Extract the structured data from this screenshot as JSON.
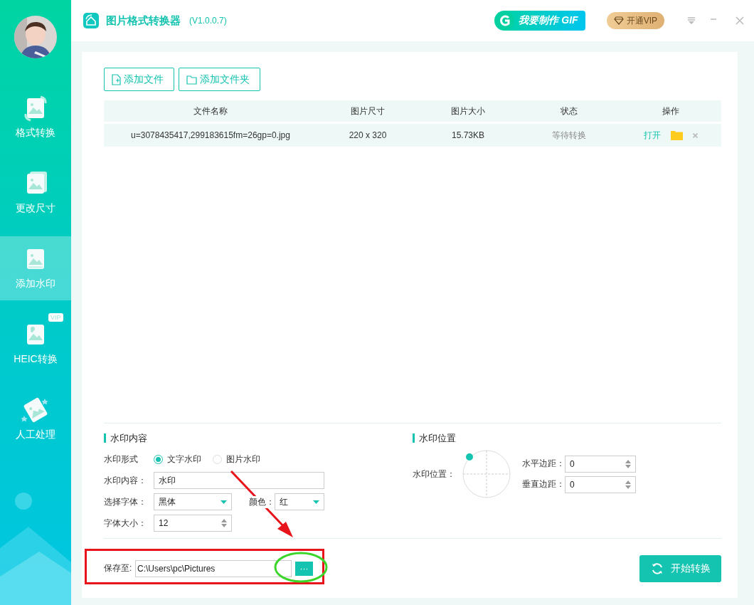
{
  "app": {
    "title": "图片格式转换器",
    "version": "(V1.0.0.7)"
  },
  "header": {
    "gif_button": "我要制作 GIF",
    "vip_button": "开通VIP"
  },
  "sidebar": {
    "items": [
      {
        "label": "格式转换",
        "selected": false,
        "kind": "convert"
      },
      {
        "label": "更改尺寸",
        "selected": false,
        "kind": "resize"
      },
      {
        "label": "添加水印",
        "selected": true,
        "kind": "watermark"
      },
      {
        "label": "HEIC转换",
        "selected": false,
        "kind": "heic",
        "badge": "VIP"
      },
      {
        "label": "人工处理",
        "selected": false,
        "kind": "manual"
      }
    ]
  },
  "toolbar": {
    "buttons": [
      {
        "label": "添加文件",
        "kind": "file"
      },
      {
        "label": "添加文件夹",
        "kind": "folder"
      }
    ]
  },
  "table": {
    "columns": [
      "文件名称",
      "图片尺寸",
      "图片大小",
      "状态",
      "操作"
    ],
    "rows": [
      {
        "name": "u=3078435417,299183615fm=26gp=0.jpg",
        "dimensions": "220 x 320",
        "size": "15.73KB",
        "status": "等待转换",
        "open_link": "打开"
      }
    ]
  },
  "watermark_content": {
    "title": "水印内容",
    "type_label": "水印形式",
    "type_options": [
      {
        "label": "文字水印",
        "selected": true
      },
      {
        "label": "图片水印",
        "selected": false
      }
    ],
    "content_label": "水印内容：",
    "content_value": "水印",
    "font_label": "选择字体：",
    "font_value": "黑体",
    "color_label": "颜色：",
    "color_value": "红",
    "size_label": "字体大小：",
    "size_value": "12"
  },
  "watermark_position": {
    "title": "水印位置",
    "dial_label": "水印位置：",
    "dial": {
      "kind": "topleft"
    },
    "horizontal_label": "水平边距：",
    "horizontal_value": "0",
    "vertical_label": "垂直边距：",
    "vertical_value": "0"
  },
  "output": {
    "label": "保存至:",
    "path": "C:\\Users\\pc\\Pictures",
    "browse_button": "···"
  },
  "start_button": "开始转换"
}
